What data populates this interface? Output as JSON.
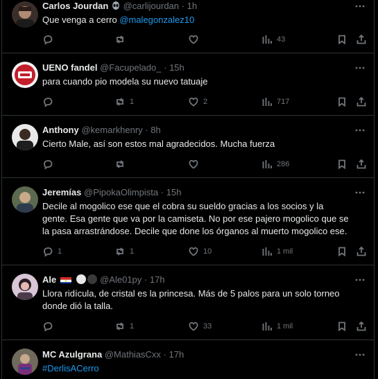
{
  "tweets": [
    {
      "name": "Carlos Jourdan",
      "handle": "@carlijourdan",
      "time": "1h",
      "text": "Que venga a cerro ",
      "mention": "@malegonzalez10",
      "replies": "",
      "retweets": "",
      "likes": "",
      "views": "43"
    },
    {
      "name": "UENO fandel",
      "handle": "@Facupelado_",
      "time": "15h",
      "text": "para cuando pio modela su nuevo tatuaje",
      "replies": "",
      "retweets": "1",
      "likes": "2",
      "views": "717"
    },
    {
      "name": "Anthony",
      "handle": "@kemarkhenry",
      "time": "8h",
      "text": "Cierto Male, así son estos mal agradecidos. Mucha fuerza",
      "replies": "",
      "retweets": "",
      "likes": "",
      "views": "286"
    },
    {
      "name": "Jeremías",
      "handle": "@PipokaOlimpista",
      "time": "15h",
      "text_lines": [
        "Decile al mogolico ese que el cobra su sueldo gracias a los socios y la",
        "gente. Esa gente que va por la camiseta. No por ese pajero mogolico que se",
        "la pasa arrastrándose. Decile que done los órganos al muerto mogolico ese."
      ],
      "replies": "1",
      "retweets": "1",
      "likes": "10",
      "views": "1 mil"
    },
    {
      "name": "Ale",
      "handle": "@Ale01py",
      "time": "17h",
      "text_lines": [
        "Llora ridícula, de cristal es la princesa. Más de 5 palos para un solo torneo",
        "donde dió la talla."
      ],
      "replies": "",
      "retweets": "1",
      "likes": "33",
      "views": "1 mil"
    },
    {
      "name": "MC Azulgrana",
      "handle": "@MathiasCxx",
      "time": "17h",
      "hashtag": "#DerlisACerro"
    }
  ],
  "separator": "·",
  "icons": {
    "reply": "reply-icon",
    "retweet": "retweet-icon",
    "like": "heart-icon",
    "views": "views-chart-icon",
    "bookmark": "bookmark-icon",
    "share": "share-icon",
    "more": "more-icon",
    "alien": "alien-emoji-icon",
    "flag": "paraguay-flag-icon"
  },
  "colors": {
    "background": "#000000",
    "text": "#e7e9ea",
    "muted": "#71767b",
    "link": "#1d9bf0",
    "border": "#2f3336"
  }
}
